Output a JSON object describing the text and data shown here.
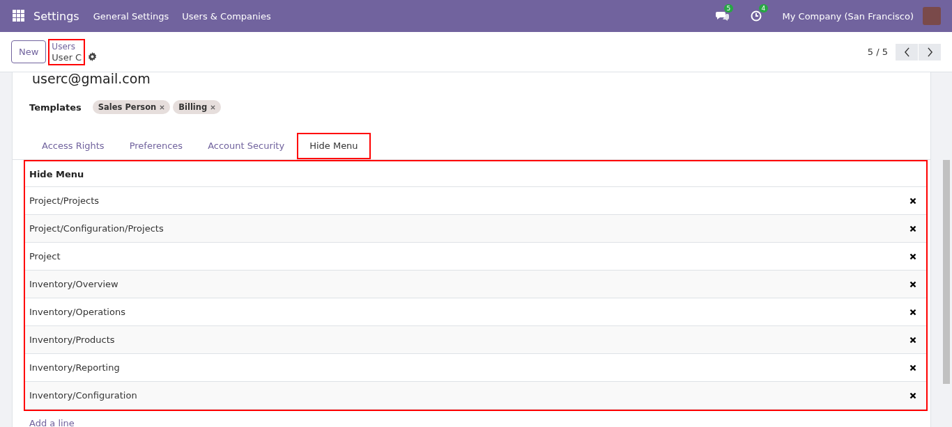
{
  "navbar": {
    "app": "Settings",
    "menus": [
      "General Settings",
      "Users & Companies"
    ],
    "messages_count": "5",
    "activities_count": "4",
    "company": "My Company (San Francisco)"
  },
  "control_panel": {
    "new_button": "New",
    "breadcrumb_parent": "Users",
    "breadcrumb_current": "User C",
    "highlighted": true,
    "pager": "5 / 5"
  },
  "form": {
    "title": "userc@gmail.com",
    "templates_label": "Templates",
    "templates": [
      "Sales Person",
      "Billing"
    ],
    "tabs": [
      {
        "label": "Access Rights",
        "selected": false,
        "highlighted": false
      },
      {
        "label": "Preferences",
        "selected": false,
        "highlighted": false
      },
      {
        "label": "Account Security",
        "selected": false,
        "highlighted": false
      },
      {
        "label": "Hide Menu",
        "selected": true,
        "highlighted": true
      }
    ],
    "table": {
      "highlighted": true,
      "columns": [
        "Hide Menu"
      ],
      "rows": [
        {
          "menu": "Project/Projects"
        },
        {
          "menu": "Project/Configuration/Projects"
        },
        {
          "menu": "Project"
        },
        {
          "menu": "Inventory/Overview"
        },
        {
          "menu": "Inventory/Operations"
        },
        {
          "menu": "Inventory/Products"
        },
        {
          "menu": "Inventory/Reporting"
        },
        {
          "menu": "Inventory/Configuration"
        }
      ],
      "add_line": "Add a line"
    }
  }
}
